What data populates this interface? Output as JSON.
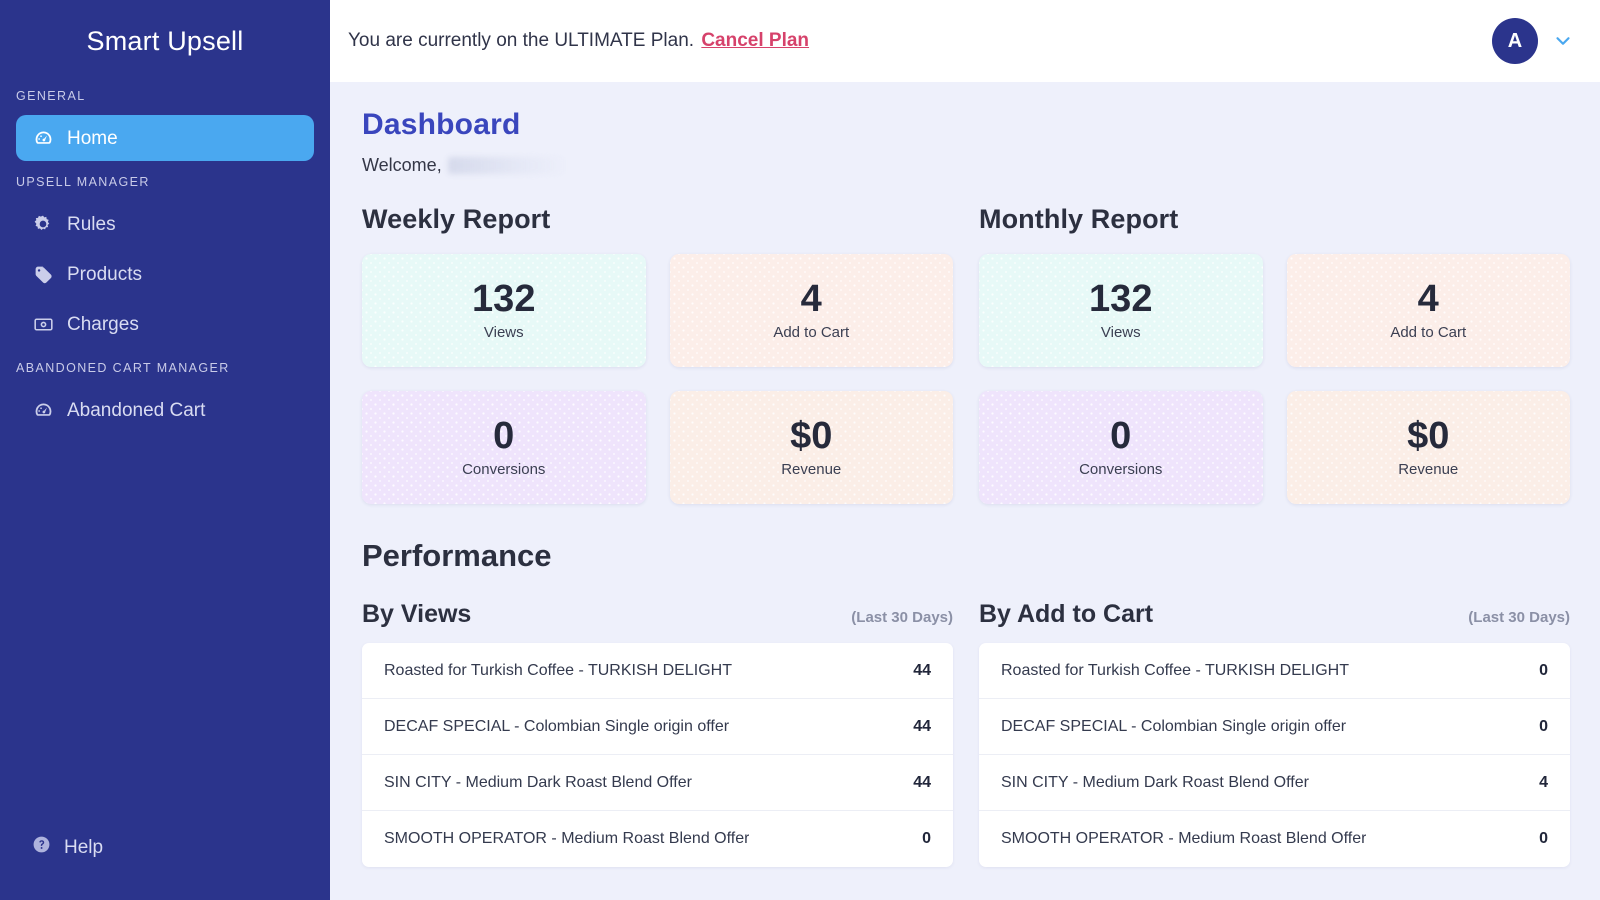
{
  "brand": {
    "name": "Smart Upsell"
  },
  "sidebar": {
    "sections": [
      {
        "label": "GENERAL",
        "items": [
          {
            "label": "Home",
            "icon": "dashboard-gauge-icon",
            "active": true
          }
        ]
      },
      {
        "label": "UPSELL MANAGER",
        "items": [
          {
            "label": "Rules",
            "icon": "gear-icon",
            "active": false
          },
          {
            "label": "Products",
            "icon": "tag-icon",
            "active": false
          },
          {
            "label": "Charges",
            "icon": "money-bill-icon",
            "active": false
          }
        ]
      },
      {
        "label": "ABANDONED CART MANAGER",
        "items": [
          {
            "label": "Abandoned Cart",
            "icon": "dashboard-gauge-icon",
            "active": false
          }
        ]
      }
    ],
    "help": {
      "label": "Help",
      "icon": "question-circle-icon"
    }
  },
  "topbar": {
    "plan_text": "You are currently on the ULTIMATE Plan.",
    "cancel_link": "Cancel Plan",
    "avatar_initial": "A",
    "chevron_icon": "chevron-down-icon"
  },
  "page": {
    "title": "Dashboard",
    "welcome_prefix": "Welcome,",
    "welcome_name_redacted": true
  },
  "reports": [
    {
      "title": "Weekly Report",
      "stats": [
        {
          "value": "132",
          "label": "Views",
          "color": "#e7f9f7"
        },
        {
          "value": "4",
          "label": "Add to Cart",
          "color": "#fceee9"
        },
        {
          "value": "0",
          "label": "Conversions",
          "color": "#efe4fc"
        },
        {
          "value": "$0",
          "label": "Revenue",
          "color": "#fbeee7"
        }
      ]
    },
    {
      "title": "Monthly Report",
      "stats": [
        {
          "value": "132",
          "label": "Views",
          "color": "#e7f9f7"
        },
        {
          "value": "4",
          "label": "Add to Cart",
          "color": "#fceee9"
        },
        {
          "value": "0",
          "label": "Conversions",
          "color": "#efe4fc"
        },
        {
          "value": "$0",
          "label": "Revenue",
          "color": "#fbeee7"
        }
      ]
    }
  ],
  "performance": {
    "title": "Performance",
    "lists": [
      {
        "title": "By Views",
        "range": "(Last 30 Days)",
        "rows": [
          {
            "name": "Roasted for Turkish Coffee - TURKISH DELIGHT",
            "value": "44"
          },
          {
            "name": "DECAF SPECIAL - Colombian Single origin offer",
            "value": "44"
          },
          {
            "name": "SIN CITY - Medium Dark Roast Blend Offer",
            "value": "44"
          },
          {
            "name": "SMOOTH OPERATOR - Medium Roast Blend Offer",
            "value": "0"
          }
        ]
      },
      {
        "title": "By Add to Cart",
        "range": "(Last 30 Days)",
        "rows": [
          {
            "name": "Roasted for Turkish Coffee - TURKISH DELIGHT",
            "value": "0"
          },
          {
            "name": "DECAF SPECIAL - Colombian Single origin offer",
            "value": "0"
          },
          {
            "name": "SIN CITY - Medium Dark Roast Blend Offer",
            "value": "4"
          },
          {
            "name": "SMOOTH OPERATOR - Medium Roast Blend Offer",
            "value": "0"
          }
        ]
      }
    ]
  },
  "colors": {
    "sidebar_bg": "#2b348c",
    "sidebar_active": "#4aa8f0",
    "content_bg": "#eef0fb",
    "title_accent": "#3a46bd",
    "link_accent": "#d6426b"
  }
}
